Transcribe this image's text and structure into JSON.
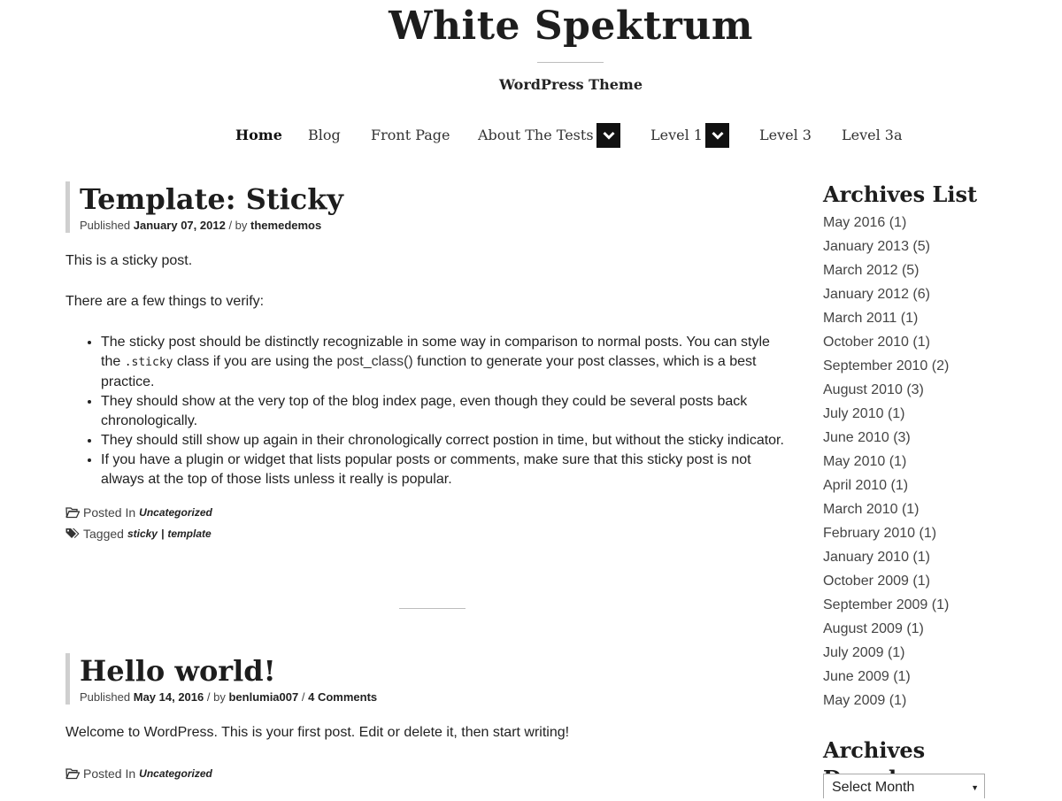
{
  "site": {
    "title": "White Spektrum",
    "tagline": "WordPress Theme"
  },
  "nav": {
    "items": [
      {
        "label": "Home"
      },
      {
        "label": "Blog"
      },
      {
        "label": "Front Page"
      },
      {
        "label": "About The Tests"
      },
      {
        "label": "Level 1"
      },
      {
        "label": "Level 3"
      },
      {
        "label": "Level 3a"
      }
    ]
  },
  "posts": [
    {
      "title": "Template: Sticky",
      "published_label": "Published",
      "date": "January 07, 2012",
      "by_label": "/ by",
      "author": "themedemos",
      "p1": "This is a sticky post.",
      "p2": "There are a few things to verify:",
      "bullets": {
        "b1_pre": "The sticky post should be distinctly recognizable in some way in comparison to normal posts. You can style the ",
        "b1_code": ".sticky",
        "b1_mid": " class if you are using the ",
        "b1_fn": "post_class()",
        "b1_post": " function to generate your post classes, which is a best practice.",
        "b2": "They should show at the very top of the blog index page, even though they could be several posts back chronologically.",
        "b3": "They should still show up again in their chronologically correct postion in time, but without the sticky indicator.",
        "b4": "If you have a plugin or widget that lists popular posts or comments, make sure that this sticky post is not always at the top of those lists unless it really is popular."
      },
      "posted_in_label": "Posted In",
      "category": "Uncategorized",
      "tagged_label": "Tagged",
      "tags": [
        "sticky",
        "template"
      ],
      "tag_sep": "|"
    },
    {
      "title": "Hello world!",
      "published_label": "Published",
      "date": "May 14, 2016",
      "by_label": "/ by",
      "author": "benlumia007",
      "comments_sep": "/",
      "comments": "4 Comments",
      "p1": "Welcome to WordPress. This is your first post. Edit or delete it, then start writing!",
      "posted_in_label": "Posted In",
      "category": "Uncategorized"
    }
  ],
  "sidebar": {
    "archives_list_title": "Archives List",
    "archives": [
      {
        "month": "May 2016",
        "count": "(1)"
      },
      {
        "month": "January 2013",
        "count": "(5)"
      },
      {
        "month": "March 2012",
        "count": "(5)"
      },
      {
        "month": "January 2012",
        "count": "(6)"
      },
      {
        "month": "March 2011",
        "count": "(1)"
      },
      {
        "month": "October 2010",
        "count": "(1)"
      },
      {
        "month": "September 2010",
        "count": "(2)"
      },
      {
        "month": "August 2010",
        "count": "(3)"
      },
      {
        "month": "July 2010",
        "count": "(1)"
      },
      {
        "month": "June 2010",
        "count": "(3)"
      },
      {
        "month": "May 2010",
        "count": "(1)"
      },
      {
        "month": "April 2010",
        "count": "(1)"
      },
      {
        "month": "March 2010",
        "count": "(1)"
      },
      {
        "month": "February 2010",
        "count": "(1)"
      },
      {
        "month": "January 2010",
        "count": "(1)"
      },
      {
        "month": "October 2009",
        "count": "(1)"
      },
      {
        "month": "September 2009",
        "count": "(1)"
      },
      {
        "month": "August 2009",
        "count": "(1)"
      },
      {
        "month": "July 2009",
        "count": "(1)"
      },
      {
        "month": "June 2009",
        "count": "(1)"
      },
      {
        "month": "May 2009",
        "count": "(1)"
      }
    ],
    "archives_dropdown_title": "Archives Dropdown",
    "select_placeholder": "Select Month"
  },
  "icons": {
    "dropdown": "chevron-down-icon",
    "folder": "folder-open-icon",
    "tags": "tags-icon"
  }
}
